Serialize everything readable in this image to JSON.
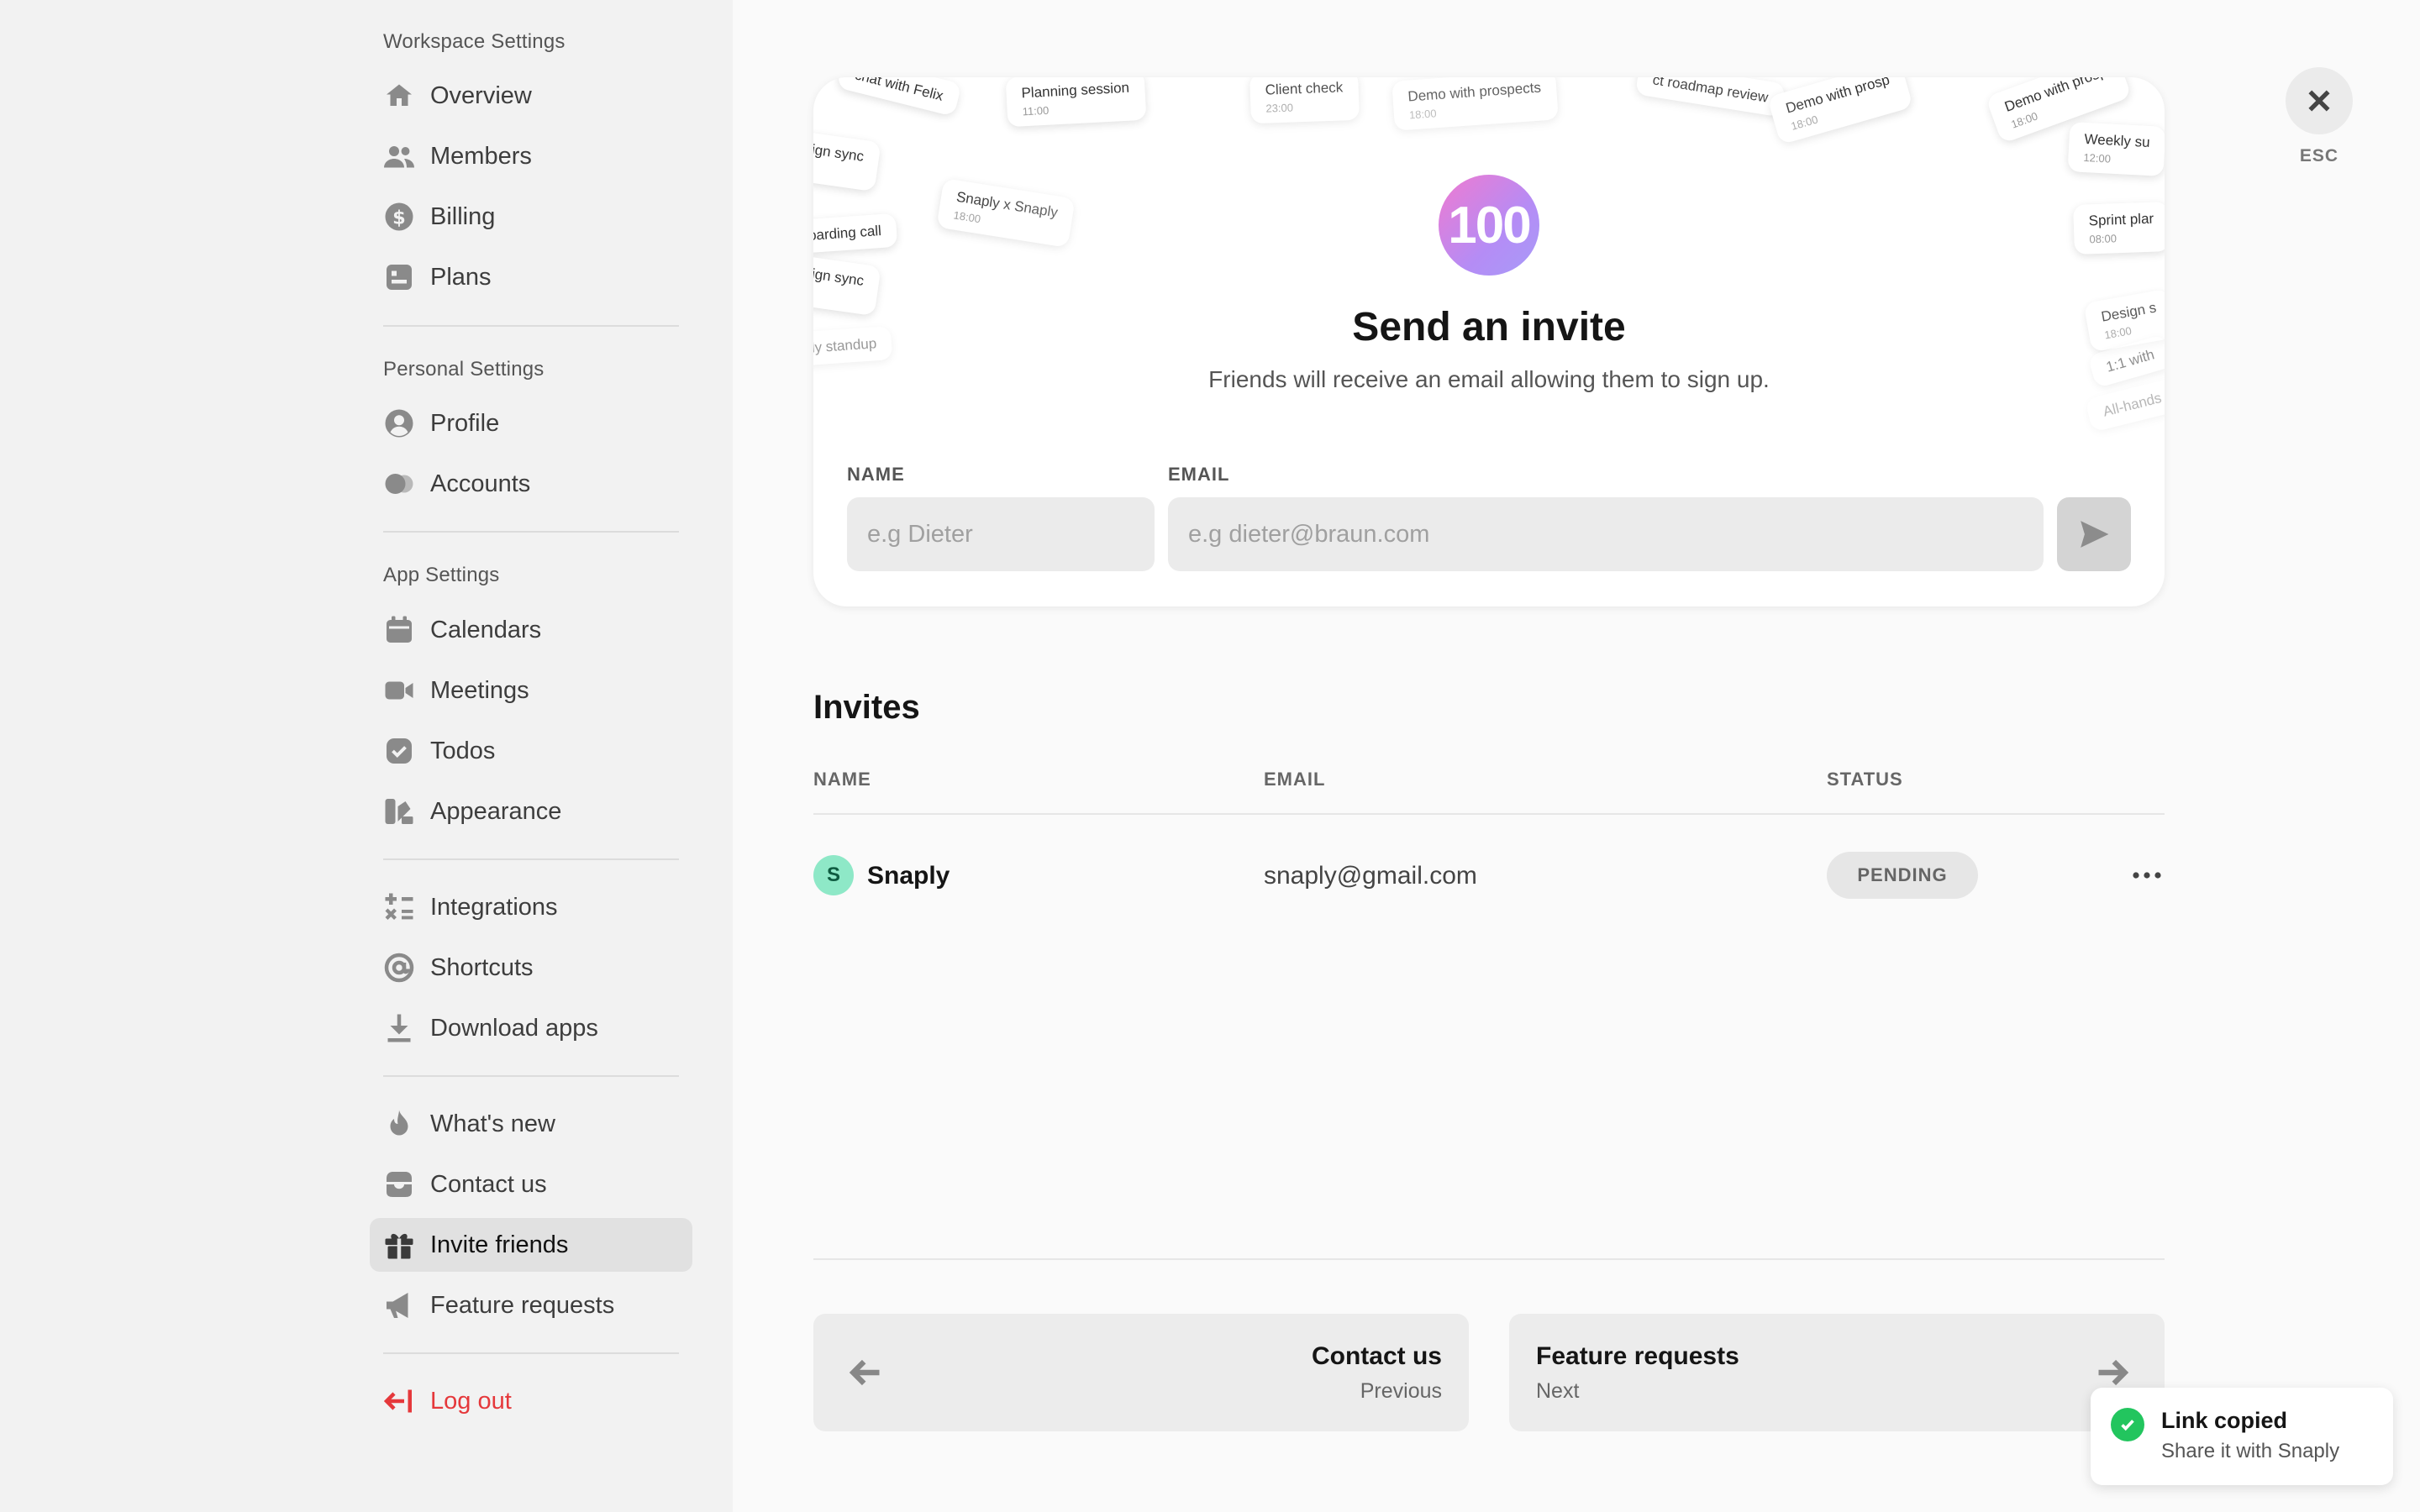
{
  "sidebar": {
    "sections": [
      {
        "title": "Workspace Settings"
      },
      {
        "title": "Personal Settings"
      },
      {
        "title": "App Settings"
      }
    ],
    "items": [
      {
        "label": "Overview",
        "icon": "home-icon"
      },
      {
        "label": "Members",
        "icon": "users-icon"
      },
      {
        "label": "Billing",
        "icon": "dollar-icon"
      },
      {
        "label": "Plans",
        "icon": "plan-icon"
      },
      {
        "label": "Profile",
        "icon": "user-circle-icon"
      },
      {
        "label": "Accounts",
        "icon": "accounts-icon"
      },
      {
        "label": "Calendars",
        "icon": "calendar-icon"
      },
      {
        "label": "Meetings",
        "icon": "video-icon"
      },
      {
        "label": "Todos",
        "icon": "check-square-icon"
      },
      {
        "label": "Appearance",
        "icon": "appearance-icon"
      },
      {
        "label": "Integrations",
        "icon": "integrations-icon"
      },
      {
        "label": "Shortcuts",
        "icon": "at-sign-icon"
      },
      {
        "label": "Download apps",
        "icon": "download-icon"
      },
      {
        "label": "What's new",
        "icon": "flame-icon"
      },
      {
        "label": "Contact us",
        "icon": "inbox-icon"
      },
      {
        "label": "Invite friends",
        "icon": "gift-icon",
        "active": true
      },
      {
        "label": "Feature requests",
        "icon": "megaphone-icon"
      },
      {
        "label": "Log out",
        "icon": "logout-icon"
      }
    ]
  },
  "invite_card": {
    "badge": "100",
    "title": "Send an invite",
    "subtitle": "Friends will receive an email allowing them to sign up.",
    "name_label": "NAME",
    "name_placeholder": "e.g Dieter",
    "email_label": "EMAIL",
    "email_placeholder": "e.g dieter@braun.com",
    "decor_events": [
      {
        "title": "chat with Felix",
        "time": ""
      },
      {
        "title": "Planning session",
        "time": "11:00"
      },
      {
        "title": "sign sync",
        "time": "0"
      },
      {
        "title": "Snaply x Snaply",
        "time": "18:00"
      },
      {
        "title": "oarding call",
        "time": ""
      },
      {
        "title": "sign sync",
        "time": "0"
      },
      {
        "title": "ily standup",
        "time": ""
      },
      {
        "title": "Client check",
        "time": "23:00"
      },
      {
        "title": "Demo with prospects",
        "time": "18:00"
      },
      {
        "title": "ct roadmap review",
        "time": ""
      },
      {
        "title": "Demo with prosp",
        "time": "18:00"
      },
      {
        "title": "Demo with prosp",
        "time": "18:00"
      },
      {
        "title": "Weekly su",
        "time": "12:00"
      },
      {
        "title": "Sprint plar",
        "time": "08:00"
      },
      {
        "title": "Design s",
        "time": "18:00"
      },
      {
        "title": "1:1 with",
        "time": ""
      },
      {
        "title": "All-hands m",
        "time": ""
      }
    ]
  },
  "esc_label": "ESC",
  "invites": {
    "title": "Invites",
    "columns": [
      "NAME",
      "EMAIL",
      "STATUS"
    ],
    "rows": [
      {
        "initial": "S",
        "name": "Snaply",
        "email": "snaply@gmail.com",
        "status": "PENDING"
      }
    ]
  },
  "pagination": {
    "prev": {
      "title": "Contact us",
      "sub": "Previous"
    },
    "next": {
      "title": "Feature requests",
      "sub": "Next"
    }
  },
  "toast": {
    "title": "Link copied",
    "subtitle": "Share it with Snaply"
  },
  "colors": {
    "accent_danger": "#e5383b",
    "success": "#22c55e",
    "avatar_bg": "#8ee8c7",
    "badge_from": "#f07ad0",
    "badge_to": "#a79bf8"
  }
}
